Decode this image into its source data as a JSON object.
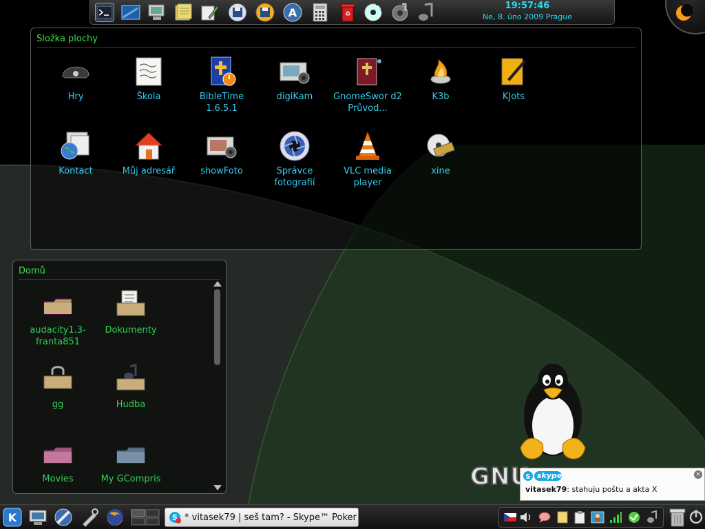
{
  "top_panel": {
    "launchers": [
      {
        "name": "terminal-icon"
      },
      {
        "name": "desktop-icon"
      },
      {
        "name": "settings-monitor-icon"
      },
      {
        "name": "notes-icon"
      },
      {
        "name": "editor-icon"
      },
      {
        "name": "floppy-save-icon"
      },
      {
        "name": "save-as-icon"
      },
      {
        "name": "font-icon"
      },
      {
        "name": "calculator-icon"
      },
      {
        "name": "trash-icon"
      },
      {
        "name": "music-player-icon"
      },
      {
        "name": "media-icon"
      },
      {
        "name": "note-icon"
      }
    ],
    "clock_time": "19:57:46",
    "clock_date": "Ne, 8. úno 2009 Prague"
  },
  "desktop_folder": {
    "title": "Složka plochy",
    "items": [
      {
        "label": "Hry",
        "icon": "helmet-icon"
      },
      {
        "label": "Škola",
        "icon": "notepad-icon"
      },
      {
        "label": "BibleTime 1.6.5.1",
        "icon": "bibletime-icon"
      },
      {
        "label": "digiKam",
        "icon": "camera-icon"
      },
      {
        "label": "GnomeSwor d2 Průvod...",
        "icon": "bible-book-icon"
      },
      {
        "label": "K3b",
        "icon": "k3b-burn-icon"
      },
      {
        "label": "KJots",
        "icon": "kjots-notebook-icon"
      },
      {
        "label": "Kontact",
        "icon": "kontact-globe-icon"
      },
      {
        "label": "Můj adresář",
        "icon": "home-icon"
      },
      {
        "label": "showFoto",
        "icon": "photo-camera-icon"
      },
      {
        "label": "Správce fotografií",
        "icon": "aperture-icon"
      },
      {
        "label": "VLC media player",
        "icon": "vlc-cone-icon"
      },
      {
        "label": "xine",
        "icon": "xine-disc-icon"
      }
    ]
  },
  "home_folder": {
    "title": "Domů",
    "items": [
      {
        "label": "audacity1.3-franta851",
        "icon": "folder-icon"
      },
      {
        "label": "Dokumenty",
        "icon": "folder-documents-icon"
      },
      {
        "label": "gg",
        "icon": "folder-locked-icon"
      },
      {
        "label": "Hudba",
        "icon": "folder-music-icon"
      },
      {
        "label": "Movies",
        "icon": "folder-pink-icon"
      },
      {
        "label": "My GCompris",
        "icon": "folder-blue-icon"
      }
    ]
  },
  "wallpaper": {
    "logo_text": "GNU",
    "colors": {
      "background": "#000000",
      "arc": "#262a26",
      "accent": "#3ce045"
    }
  },
  "skype_popup": {
    "brand": "skype",
    "sender": "vitasek79",
    "message": ": stahuju poštu a akta X",
    "close_symbol": "×"
  },
  "taskbar": {
    "task_label": "* vitasek79 | seš tam? - Skype™ Poker"
  }
}
